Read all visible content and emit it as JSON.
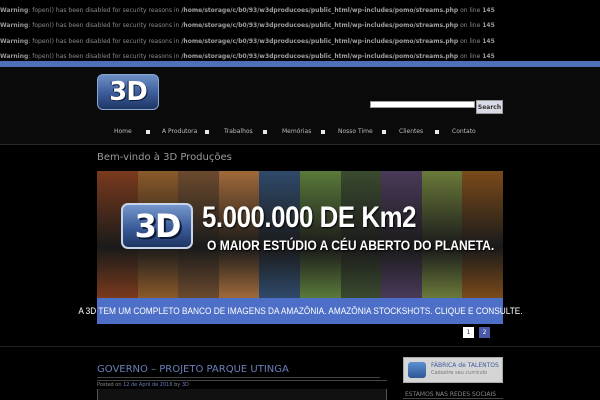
{
  "warnings": [
    {
      "label": "Warning",
      "msg": ": fopen() has been disabled for security reasons in ",
      "path": "/home/storage/c/b0/93/w3dproducoes/public_html/wp-includes/pomo/streams.php",
      "line_text": " on line ",
      "line": "145"
    },
    {
      "label": "Warning",
      "msg": ": fopen() has been disabled for security reasons in ",
      "path": "/home/storage/c/b0/93/w3dproducoes/public_html/wp-includes/pomo/streams.php",
      "line_text": " on line ",
      "line": "145"
    },
    {
      "label": "Warning",
      "msg": ": fopen() has been disabled for security reasons in ",
      "path": "/home/storage/c/b0/93/w3dproducoes/public_html/wp-includes/pomo/streams.php",
      "line_text": " on line ",
      "line": "145"
    },
    {
      "label": "Warning",
      "msg": ": fopen() has been disabled for security reasons in ",
      "path": "/home/storage/c/b0/93/w3dproducoes/public_html/wp-includes/pomo/streams.php",
      "line_text": " on line ",
      "line": "145"
    }
  ],
  "header": {
    "logo_text": "3D",
    "search_button": "Search",
    "search_value": ""
  },
  "nav": [
    "Home",
    "A Produtora",
    "Trabalhos",
    "Memórias",
    "Nosso Time",
    "Clientes",
    "Contato"
  ],
  "welcome": "Bem-vindo à 3D Produções",
  "banner": {
    "logo_text": "3D",
    "headline": "5.000.000 DE Km2",
    "subheadline": "O MAIOR ESTÚDIO A CÉU ABERTO DO PLANETA.",
    "caption": "A 3D TEM UM COMPLETO BANCO DE IMAGENS DA AMAZÔNIA. AMAZÔNIA STOCKSHOTS. CLIQUE E CONSULTE.",
    "strip_colors": [
      "#7a3a1c",
      "#8a5a2a",
      "#6b4a2e",
      "#a06a3a",
      "#2f4a6a",
      "#5a7a3a",
      "#3a4a2e",
      "#4a3a5a",
      "#6a7a3a",
      "#7a4a1a"
    ]
  },
  "pager": [
    "1",
    "2"
  ],
  "post": {
    "title": "GOVERNO – PROJETO PARQUE UTINGA",
    "posted_on": "Posted on ",
    "date": "12 de April de 2016",
    "by": " by ",
    "author": "3D"
  },
  "sidebar": {
    "widget_title": "FÁBRICA de TALENTOS",
    "widget_sub": "Cadastre seu currículo",
    "social_title": "ESTAMOS NAS REDES SOCIAIS"
  },
  "colors": {
    "accent": "#4f6fb9",
    "caption_bar": "#4d6fc7",
    "link": "#6b7fb8"
  }
}
